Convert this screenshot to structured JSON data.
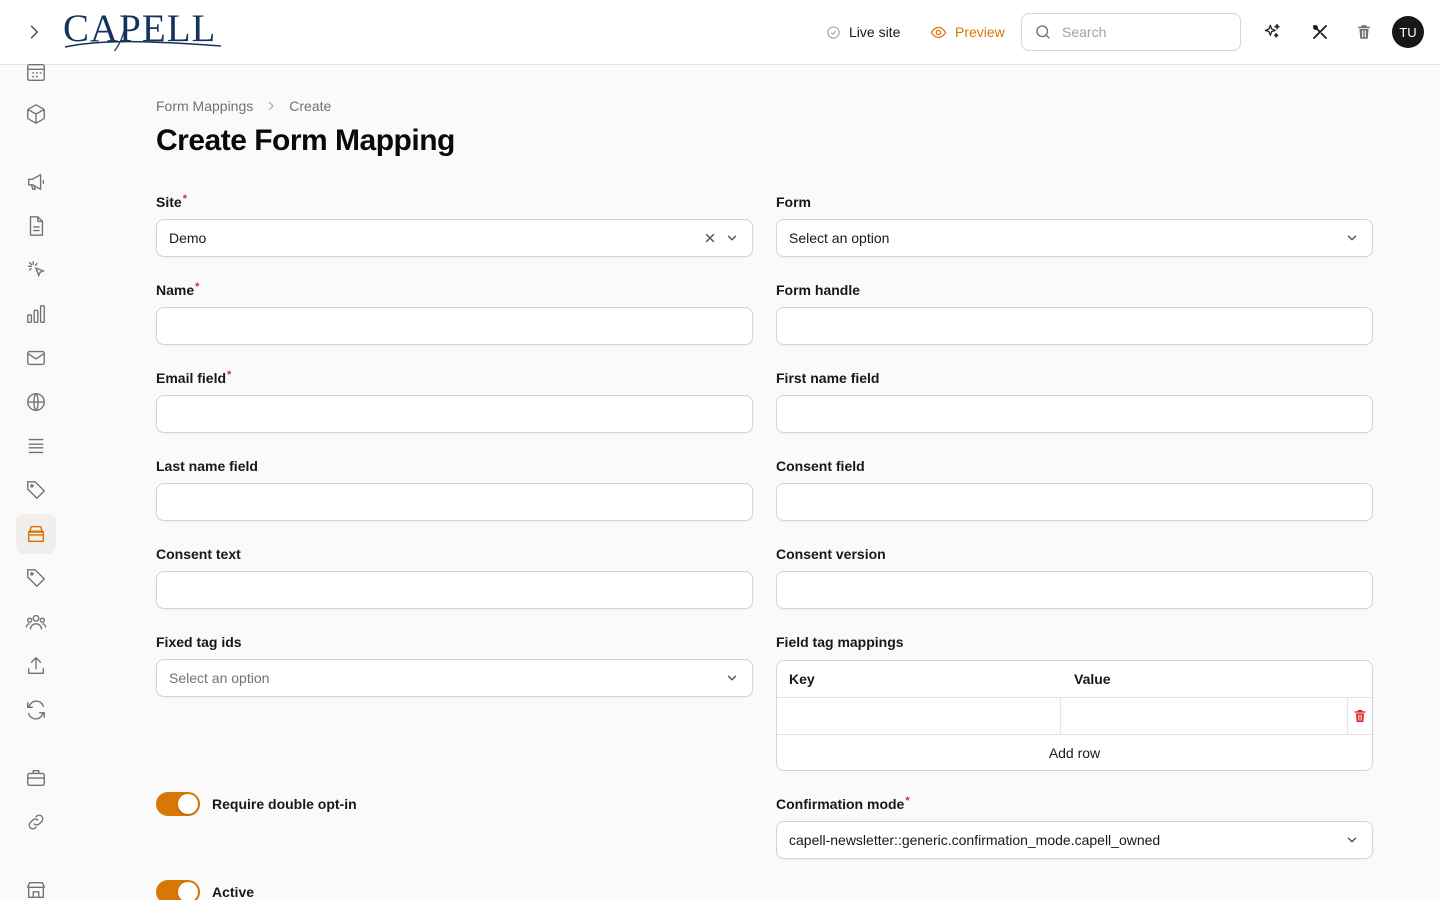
{
  "header": {
    "logo_text": "CAPELL",
    "live_site_label": "Live site",
    "preview_label": "Preview",
    "search_placeholder": "Search",
    "avatar_initials": "TU",
    "accent_color": "#d97706"
  },
  "sidebar": {
    "items": [
      {
        "icon": "calendar-icon"
      },
      {
        "icon": "cube-icon"
      },
      {
        "icon": "megaphone-icon"
      },
      {
        "icon": "document-icon"
      },
      {
        "icon": "cursor-click-icon"
      },
      {
        "icon": "bar-chart-icon"
      },
      {
        "icon": "envelope-icon"
      },
      {
        "icon": "globe-icon"
      },
      {
        "icon": "queue-list-icon"
      },
      {
        "icon": "tag-icon"
      },
      {
        "icon": "inbox-stack-icon",
        "active": true
      },
      {
        "icon": "tag-icon"
      },
      {
        "icon": "user-group-icon"
      },
      {
        "icon": "upload-icon"
      },
      {
        "icon": "refresh-icon"
      },
      {
        "icon": "briefcase-icon"
      },
      {
        "icon": "link-icon"
      },
      {
        "icon": "storefront-icon"
      }
    ]
  },
  "breadcrumb": {
    "parent": "Form Mappings",
    "current": "Create"
  },
  "page_title": "Create Form Mapping",
  "form": {
    "site": {
      "label": "Site",
      "value": "Demo"
    },
    "form": {
      "label": "Form",
      "placeholder": "Select an option"
    },
    "name": {
      "label": "Name",
      "value": ""
    },
    "form_handle": {
      "label": "Form handle",
      "value": ""
    },
    "email_field": {
      "label": "Email field",
      "value": ""
    },
    "first_name_field": {
      "label": "First name field",
      "value": ""
    },
    "last_name_field": {
      "label": "Last name field",
      "value": ""
    },
    "consent_field": {
      "label": "Consent field",
      "value": ""
    },
    "consent_text": {
      "label": "Consent text",
      "value": ""
    },
    "consent_version": {
      "label": "Consent version",
      "value": ""
    },
    "fixed_tag_ids": {
      "label": "Fixed tag ids",
      "placeholder": "Select an option"
    },
    "field_tag_mappings": {
      "label": "Field tag mappings",
      "key_header": "Key",
      "value_header": "Value",
      "add_row_label": "Add row"
    },
    "require_double_opt_in": {
      "label": "Require double opt-in",
      "on": true
    },
    "confirmation_mode": {
      "label": "Confirmation mode",
      "value": "capell-newsletter::generic.confirmation_mode.capell_owned"
    },
    "active": {
      "label": "Active",
      "on": true
    }
  }
}
